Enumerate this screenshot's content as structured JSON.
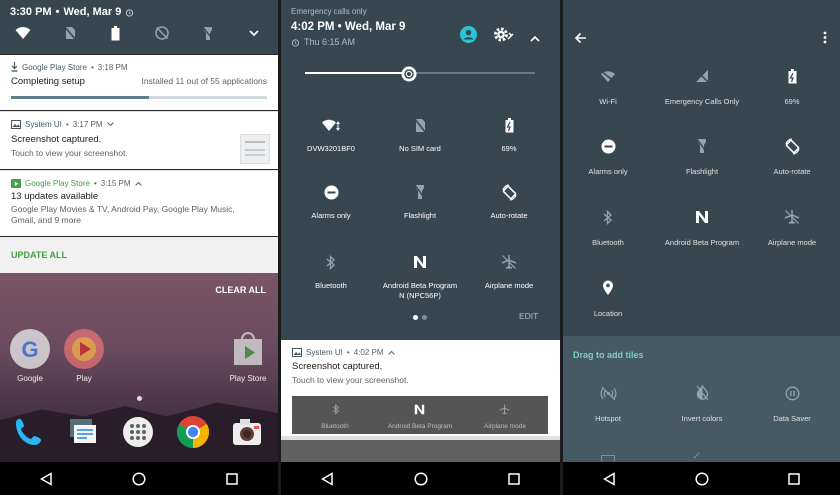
{
  "panel1": {
    "status": {
      "time": "3:30 PM",
      "date": "Wed, Mar 9"
    },
    "notifications": [
      {
        "app": "Google Play Store",
        "time": "3:18 PM",
        "title": "Completing setup",
        "detail": "Installed 11 out of 55 applications",
        "progress": 0.54
      },
      {
        "app": "System UI",
        "time": "3:17 PM",
        "title": "Screenshot captured.",
        "subtitle": "Touch to view your screenshot."
      },
      {
        "app": "Google Play Store",
        "time": "3:15 PM",
        "title": "13 updates available",
        "body_line1": "Google Play Movies & TV, Android Pay, Google Play Music,",
        "body_line2": "Gmail, and 9 more",
        "action": "UPDATE ALL"
      }
    ],
    "clear_all": "CLEAR ALL",
    "home_apps": [
      {
        "label": "Google"
      },
      {
        "label": "Play"
      },
      {
        "label": "Play Store"
      }
    ]
  },
  "panel2": {
    "emergency": "Emergency calls only",
    "time": "4:02 PM",
    "date": "Wed, Mar 9",
    "alarm": "Thu 6:15 AM",
    "brightness": 0.45,
    "tiles": [
      {
        "label": "DVW3201BF0",
        "icon": "wifi-icon"
      },
      {
        "label": "No SIM card",
        "icon": "no-sim-icon"
      },
      {
        "label": "69%",
        "icon": "battery-icon"
      },
      {
        "label": "Alarms only",
        "icon": "alarms-only-icon"
      },
      {
        "label": "Flashlight",
        "icon": "flashlight-icon"
      },
      {
        "label": "Auto-rotate",
        "icon": "auto-rotate-icon"
      },
      {
        "label": "Bluetooth",
        "icon": "bluetooth-icon"
      },
      {
        "label": "Android Beta Program",
        "label2": "N (NPC56P)",
        "icon": "android-n-icon"
      },
      {
        "label": "Airplane mode",
        "icon": "airplane-icon"
      }
    ],
    "edit": "EDIT",
    "notification": {
      "app": "System UI",
      "time": "4:02 PM",
      "title": "Screenshot captured.",
      "subtitle": "Touch to view your screenshot."
    },
    "screenshot_labels": [
      "Bluetooth",
      "Android Beta Program",
      "Airplane mode"
    ]
  },
  "panel3": {
    "tiles": [
      {
        "label": "Wi-Fi",
        "icon": "wifi-icon"
      },
      {
        "label": "Emergency Calls Only",
        "icon": "signal-off-icon"
      },
      {
        "label": "69%",
        "icon": "battery-icon"
      },
      {
        "label": "Alarms only",
        "icon": "alarms-only-icon"
      },
      {
        "label": "Flashlight",
        "icon": "flashlight-icon"
      },
      {
        "label": "Auto-rotate",
        "icon": "auto-rotate-icon"
      },
      {
        "label": "Bluetooth",
        "icon": "bluetooth-icon"
      },
      {
        "label": "Android Beta Program",
        "icon": "android-n-icon"
      },
      {
        "label": "Airplane mode",
        "icon": "airplane-icon"
      },
      {
        "label": "Location",
        "icon": "location-icon"
      }
    ],
    "drag_title": "Drag to add tiles",
    "extra_tiles": [
      {
        "label": "Hotspot",
        "icon": "hotspot-icon"
      },
      {
        "label": "Invert colors",
        "icon": "invert-colors-icon"
      },
      {
        "label": "Data Saver",
        "icon": "data-saver-icon"
      }
    ]
  },
  "colors": {
    "accent_teal": "#26c6da",
    "qs_bg": "#37474f",
    "green": "#43a047"
  }
}
